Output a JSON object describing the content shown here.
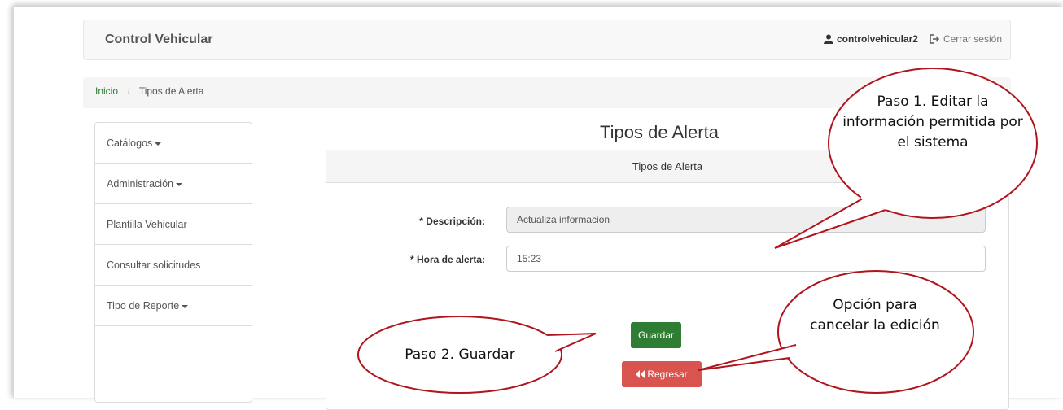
{
  "app": {
    "title": "Control Vehicular",
    "user": "controlvehicular2",
    "logout": "Cerrar sesión"
  },
  "breadcrumb": {
    "home": "Inicio",
    "separator": "/",
    "current": "Tipos de Alerta"
  },
  "sidebar": {
    "items": [
      {
        "label": "Catálogos",
        "dropdown": true
      },
      {
        "label": "Administración",
        "dropdown": true
      },
      {
        "label": "Plantilla Vehicular",
        "dropdown": false
      },
      {
        "label": "Consultar solicitudes",
        "dropdown": false
      },
      {
        "label": "Tipo de Reporte",
        "dropdown": true
      }
    ]
  },
  "main": {
    "title": "Tipos de Alerta",
    "panel_title": "Tipos de Alerta",
    "form": {
      "descripcion_label": "* Descripción:",
      "descripcion_value": "Actualiza informacion",
      "hora_label": "* Hora de alerta:",
      "hora_value": "15:23"
    },
    "buttons": {
      "save": "Guardar",
      "back": "Regresar"
    }
  },
  "annotations": {
    "step1": "Paso 1. Editar la información permitida por el sistema",
    "step2": "Paso 2. Guardar",
    "cancel": "Opción para cancelar la edición"
  },
  "colors": {
    "primary_green": "#2e7d32",
    "danger_red": "#d9534f",
    "callout_border": "#b0141c"
  },
  "icons": {
    "user": "user-icon",
    "logout": "logout-icon",
    "back": "double-chevron-left-icon"
  }
}
